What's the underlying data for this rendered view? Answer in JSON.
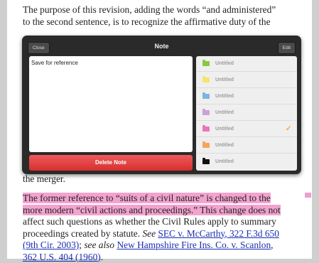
{
  "document": {
    "para1_line1": "The purpose of this revision, adding the words “and administered”",
    "para1_line2": "to the second sentence, is to recognize the affirmative duty of the",
    "para_after": "the merger.",
    "para2_line1": "The former reference to “suits of a civil nature” is changed to the",
    "para2_line2": "more modern “civil actions and proceedings.” This change does not",
    "para2_line3": "affect such questions as whether the Civil Rules apply to summary",
    "para2_line4_pre": "proceedings created by statute. ",
    "para2_see": "See",
    "para2_link1a": "SEC v. McCarthy",
    "para2_link1b": ", 322 F.3d 650",
    "para2_link1c": "(9th Cir. 2003)",
    "para2_mid": "; ",
    "para2_see_also": "see also",
    "para2_link2a": "New Hampshire Fire Ins. Co. v. Scanlon",
    "para2_link2b": ",",
    "para2_link2c": "362 U.S. 404 (1960)",
    "para2_end": "."
  },
  "note_popup": {
    "title": "Note",
    "close_label": "Close",
    "edit_label": "Edit",
    "note_text": "Save for reference",
    "delete_label": "Delete Note",
    "colors": [
      {
        "label": "Untitled",
        "color": "#8cc63f",
        "selected": false
      },
      {
        "label": "Untitled",
        "color": "#f5e56b",
        "selected": false
      },
      {
        "label": "Untitled",
        "color": "#7ab4e0",
        "selected": false
      },
      {
        "label": "Untitled",
        "color": "#c9a3d3",
        "selected": false
      },
      {
        "label": "Untitled",
        "color": "#ea74b4",
        "selected": true
      },
      {
        "label": "Untitled",
        "color": "#f5a45a",
        "selected": false
      },
      {
        "label": "Untitled",
        "color": "#111111",
        "selected": false
      }
    ],
    "check_icon": "checkmark-icon"
  },
  "accent_colors": {
    "highlight": "#f3a3cf",
    "delete": "#d82f2f",
    "check": "#f08a1d"
  }
}
